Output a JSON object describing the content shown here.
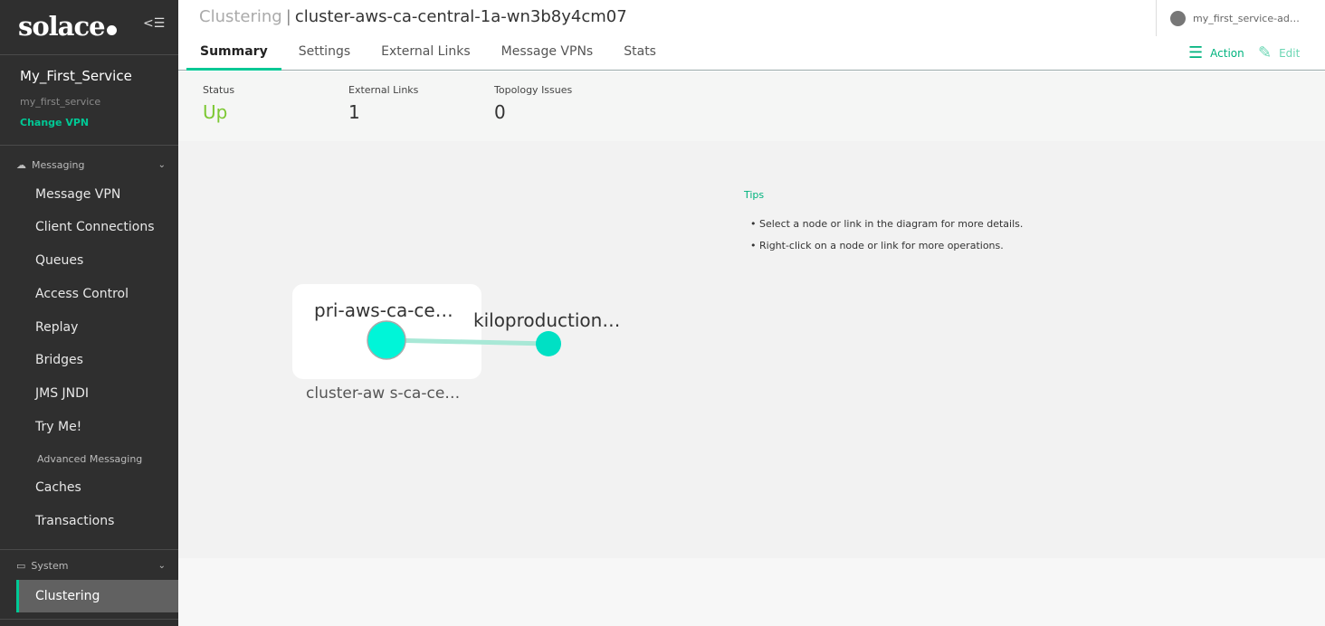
{
  "sidebar": {
    "logo": "solace",
    "service_name": "My_First_Service",
    "vpn_name": "my_first_service",
    "change_vpn": "Change VPN",
    "messaging_label": "Messaging",
    "items": [
      "Message VPN",
      "Client Connections",
      "Queues",
      "Access Control",
      "Replay",
      "Bridges",
      "JMS JNDI",
      "Try Me!"
    ],
    "advanced_label": "Advanced Messaging",
    "advanced_items": [
      "Caches",
      "Transactions"
    ],
    "system_label": "System",
    "selected": "Clustering"
  },
  "header": {
    "section": "Clustering",
    "title": "cluster-aws-ca-central-1a-wn3b8y4cm07",
    "user": "my_first_service-ad…",
    "tabs": [
      "Summary",
      "Settings",
      "External Links",
      "Message VPNs",
      "Stats"
    ],
    "action": "Action",
    "edit": "Edit"
  },
  "stats": [
    {
      "label": "Status",
      "value": "Up"
    },
    {
      "label": "External Links",
      "value": "1"
    },
    {
      "label": "Topology Issues",
      "value": "0"
    }
  ],
  "diagram": {
    "node_primary": "pri-aws-ca-ce…",
    "node_remote": "kiloproduction…",
    "cluster_label": "cluster-aw s-ca-ce…",
    "tips_title": "Tips",
    "tips": [
      "Select a node or link in the diagram for more details.",
      "Right-click on a node or link for more operations."
    ]
  },
  "colors": {
    "accent": "#00c895",
    "status_up": "#7cc832",
    "node": "#00f5d8"
  }
}
